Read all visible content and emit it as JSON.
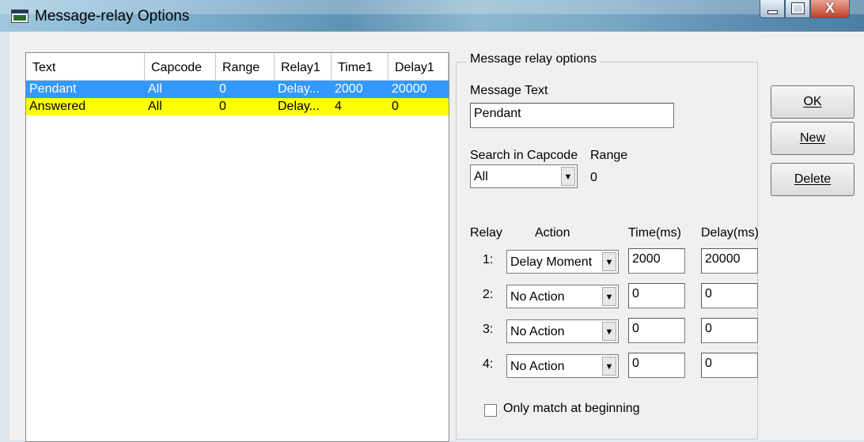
{
  "window": {
    "title": "Message-relay Options",
    "close_glyph": "X"
  },
  "list": {
    "columns": [
      "Text",
      "Capcode",
      "Range",
      "Relay1",
      "Time1",
      "Delay1"
    ],
    "rows": [
      [
        "Pendant",
        "All",
        "0",
        "Delay...",
        "2000",
        "20000"
      ],
      [
        "Answered",
        "All",
        "0",
        "Delay...",
        "4",
        "0"
      ]
    ]
  },
  "panel": {
    "group_title": "Message relay options",
    "message_text_label": "Message Text",
    "message_text_value": "Pendant",
    "search_capcode_label": "Search in Capcode",
    "range_label": "Range",
    "capcode_value": "All",
    "range_value": "0",
    "headers": {
      "relay": "Relay",
      "action": "Action",
      "time": "Time(ms)",
      "delay": "Delay(ms)"
    },
    "relays": [
      {
        "num": "1:",
        "action": "Delay Moment",
        "time": "2000",
        "delay": "20000"
      },
      {
        "num": "2:",
        "action": "No Action",
        "time": "0",
        "delay": "0"
      },
      {
        "num": "3:",
        "action": "No Action",
        "time": "0",
        "delay": "0"
      },
      {
        "num": "4:",
        "action": "No Action",
        "time": "0",
        "delay": "0"
      }
    ],
    "only_match_label": "Only match at beginning",
    "only_match_checked": false
  },
  "buttons": {
    "ok": "OK",
    "new": "New",
    "delete": "Delete"
  },
  "icons": {
    "app": "terminal-window-icon",
    "dropdown": "chevron-down-icon"
  },
  "colors": {
    "selected_row": "#3399ff",
    "highlight_row": "#ffff00"
  }
}
